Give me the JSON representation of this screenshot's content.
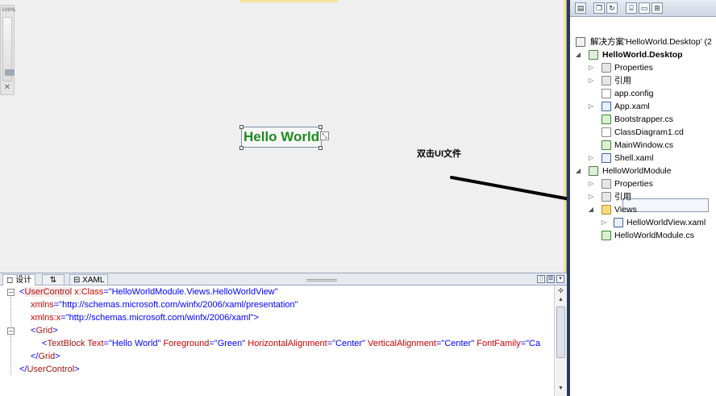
{
  "designer": {
    "zoom_label": "100%",
    "hello_text": "Hello World",
    "annotation": "双击UI文件"
  },
  "tabs": {
    "design": "设计",
    "swap": "⇅",
    "xaml": "XAML"
  },
  "xaml": {
    "line1_open": "<",
    "line1_tag": "UserControl",
    "line1_attr": " x:Class",
    "line1_eq": "=",
    "line1_val": "\"HelloWorldModule.Views.HelloWorldView\"",
    "line2_attr": "xmlns",
    "line2_eq": "=",
    "line2_val": "\"http://schemas.microsoft.com/winfx/2006/xaml/presentation\"",
    "line3_attr": "xmlns:x",
    "line3_eq": "=",
    "line3_val": "\"http://schemas.microsoft.com/winfx/2006/xaml\"",
    "line3_close": ">",
    "line4_open": "<",
    "line4_tag": "Grid",
    "line4_close": ">",
    "line5_open": "<",
    "line5_tag": "TextBlock",
    "line5_a1": " Text",
    "line5_v1": "=\"Hello World\"",
    "line5_a2": " Foreground",
    "line5_v2": "=\"Green\"",
    "line5_a3": " HorizontalAlignment",
    "line5_v3": "=\"Center\"",
    "line5_a4": " VerticalAlignment",
    "line5_v4": "=\"Center\"",
    "line5_a5": " FontFamily",
    "line5_v5": "=\"Ca",
    "line6_open": "</",
    "line6_tag": "Grid",
    "line6_close": ">",
    "line7_open": "</",
    "line7_tag": "UserControl",
    "line7_close": ">"
  },
  "solution": {
    "items": [
      {
        "label": "解决方案'HelloWorld.Desktop' (2"
      },
      {
        "label": "HelloWorld.Desktop"
      },
      {
        "label": "Properties"
      },
      {
        "label": "引用"
      },
      {
        "label": "app.config"
      },
      {
        "label": "App.xaml"
      },
      {
        "label": "Bootstrapper.cs"
      },
      {
        "label": "ClassDiagram1.cd"
      },
      {
        "label": "MainWindow.cs"
      },
      {
        "label": "Shell.xaml"
      },
      {
        "label": "HelloWorldModule"
      },
      {
        "label": "Properties"
      },
      {
        "label": "引用"
      },
      {
        "label": "Views"
      },
      {
        "label": "HelloWorldView.xaml"
      },
      {
        "label": "HelloWorldModule.cs"
      }
    ]
  }
}
